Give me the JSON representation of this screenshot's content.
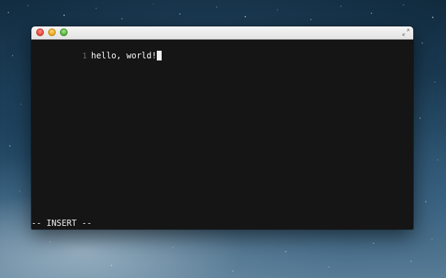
{
  "terminal": {
    "lines": [
      {
        "number": "1",
        "text": "hello, world!"
      }
    ],
    "mode": "-- INSERT --"
  },
  "titlebar": {
    "icons": [
      "close-icon",
      "minimize-icon",
      "zoom-icon",
      "fullscreen-icon"
    ]
  },
  "colors": {
    "editor_background": "#151515",
    "text": "#ffffff",
    "line_number": "#6d6d6d",
    "close": "#e0443a",
    "minimize": "#e1a21d",
    "zoom": "#4fad37"
  }
}
